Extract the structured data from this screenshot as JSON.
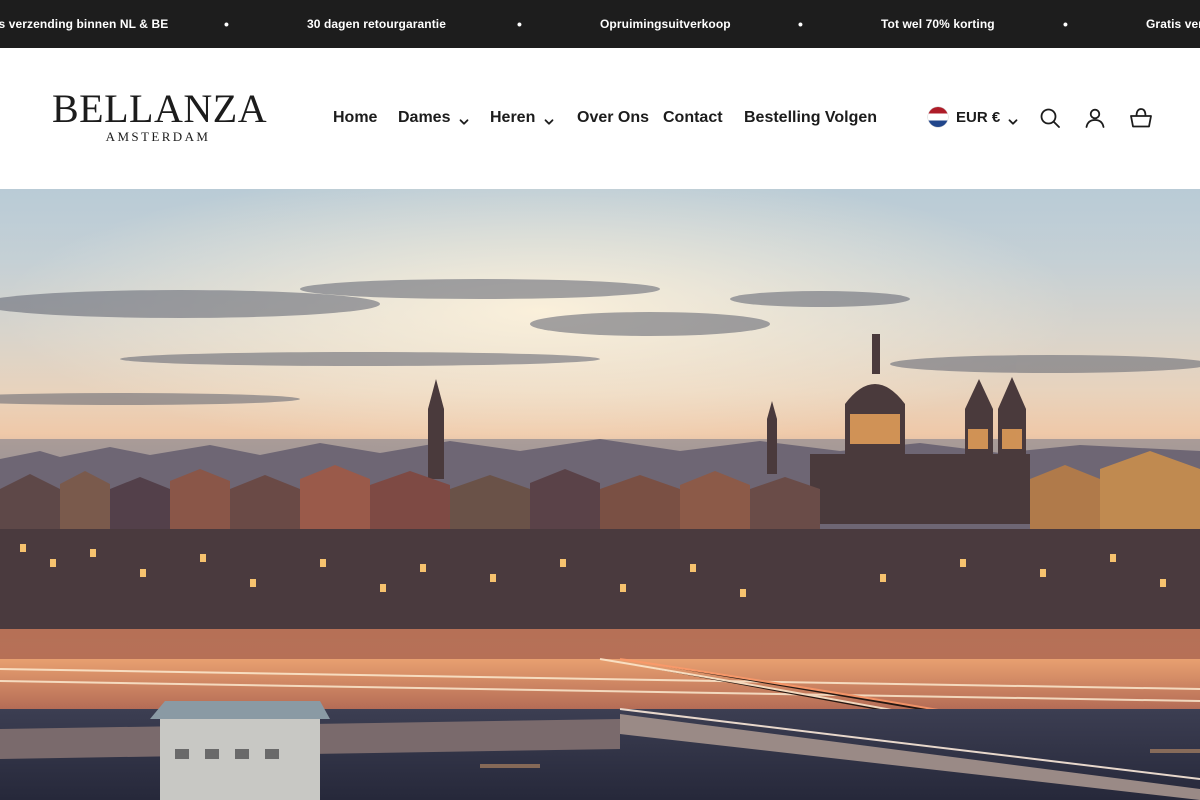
{
  "announcement_bar": {
    "messages": [
      "Gratis verzending binnen NL & BE",
      "30 dagen retourgarantie",
      "Opruimingsuitverkoop",
      "Tot wel 70% korting",
      "Gratis verzending binnen NL & BE"
    ],
    "separator": "•"
  },
  "header": {
    "logo": {
      "brand": "BELLANZA",
      "city": "AMSTERDAM"
    },
    "nav": [
      {
        "label": "Home",
        "has_dropdown": false
      },
      {
        "label": "Dames",
        "has_dropdown": true
      },
      {
        "label": "Heren",
        "has_dropdown": true
      },
      {
        "label": "Over Ons",
        "has_dropdown": false
      },
      {
        "label": "Contact",
        "has_dropdown": false
      },
      {
        "label": "Bestelling Volgen",
        "has_dropdown": false
      }
    ],
    "currency": {
      "code": "EUR €",
      "flag": "netherlands-flag-icon"
    },
    "icons": [
      "search-icon",
      "account-icon",
      "cart-icon"
    ]
  },
  "hero": {
    "image": "amsterdam-skyline-sunset-photo"
  },
  "colors": {
    "announcement_bg": "#1d1d1d",
    "text": "#1c1c1c",
    "background": "#ffffff"
  }
}
